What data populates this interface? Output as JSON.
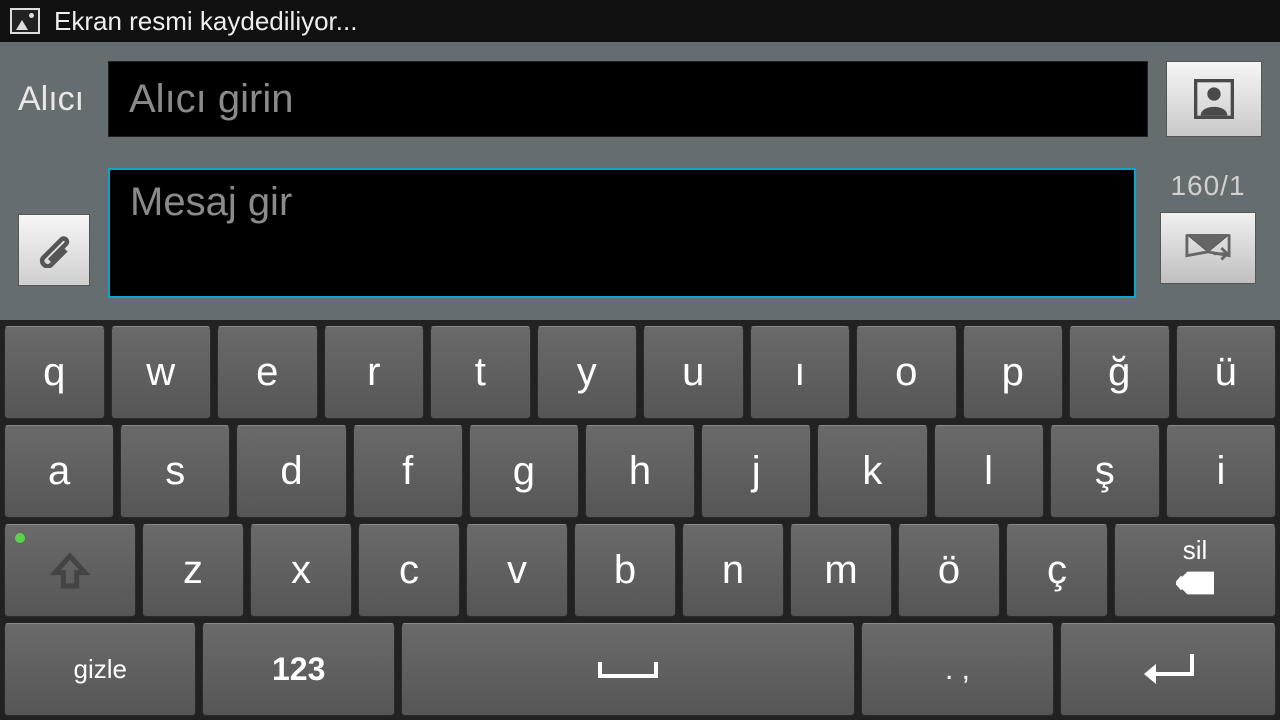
{
  "statusbar": {
    "text": "Ekran resmi kaydediliyor..."
  },
  "compose": {
    "recipient_label": "Alıcı",
    "recipient_placeholder": "Alıcı girin",
    "message_placeholder": "Mesaj gir",
    "char_counter": "160/1"
  },
  "keyboard": {
    "row1": [
      "q",
      "w",
      "e",
      "r",
      "t",
      "y",
      "u",
      "ı",
      "o",
      "p",
      "ğ",
      "ü"
    ],
    "row2": [
      "a",
      "s",
      "d",
      "f",
      "g",
      "h",
      "j",
      "k",
      "l",
      "ş",
      "i"
    ],
    "row3_letters": [
      "z",
      "x",
      "c",
      "v",
      "b",
      "n",
      "m",
      "ö",
      "ç"
    ],
    "delete_label": "sil",
    "hide_label": "gizle",
    "num_label": "123",
    "punct_label": ". ,"
  }
}
